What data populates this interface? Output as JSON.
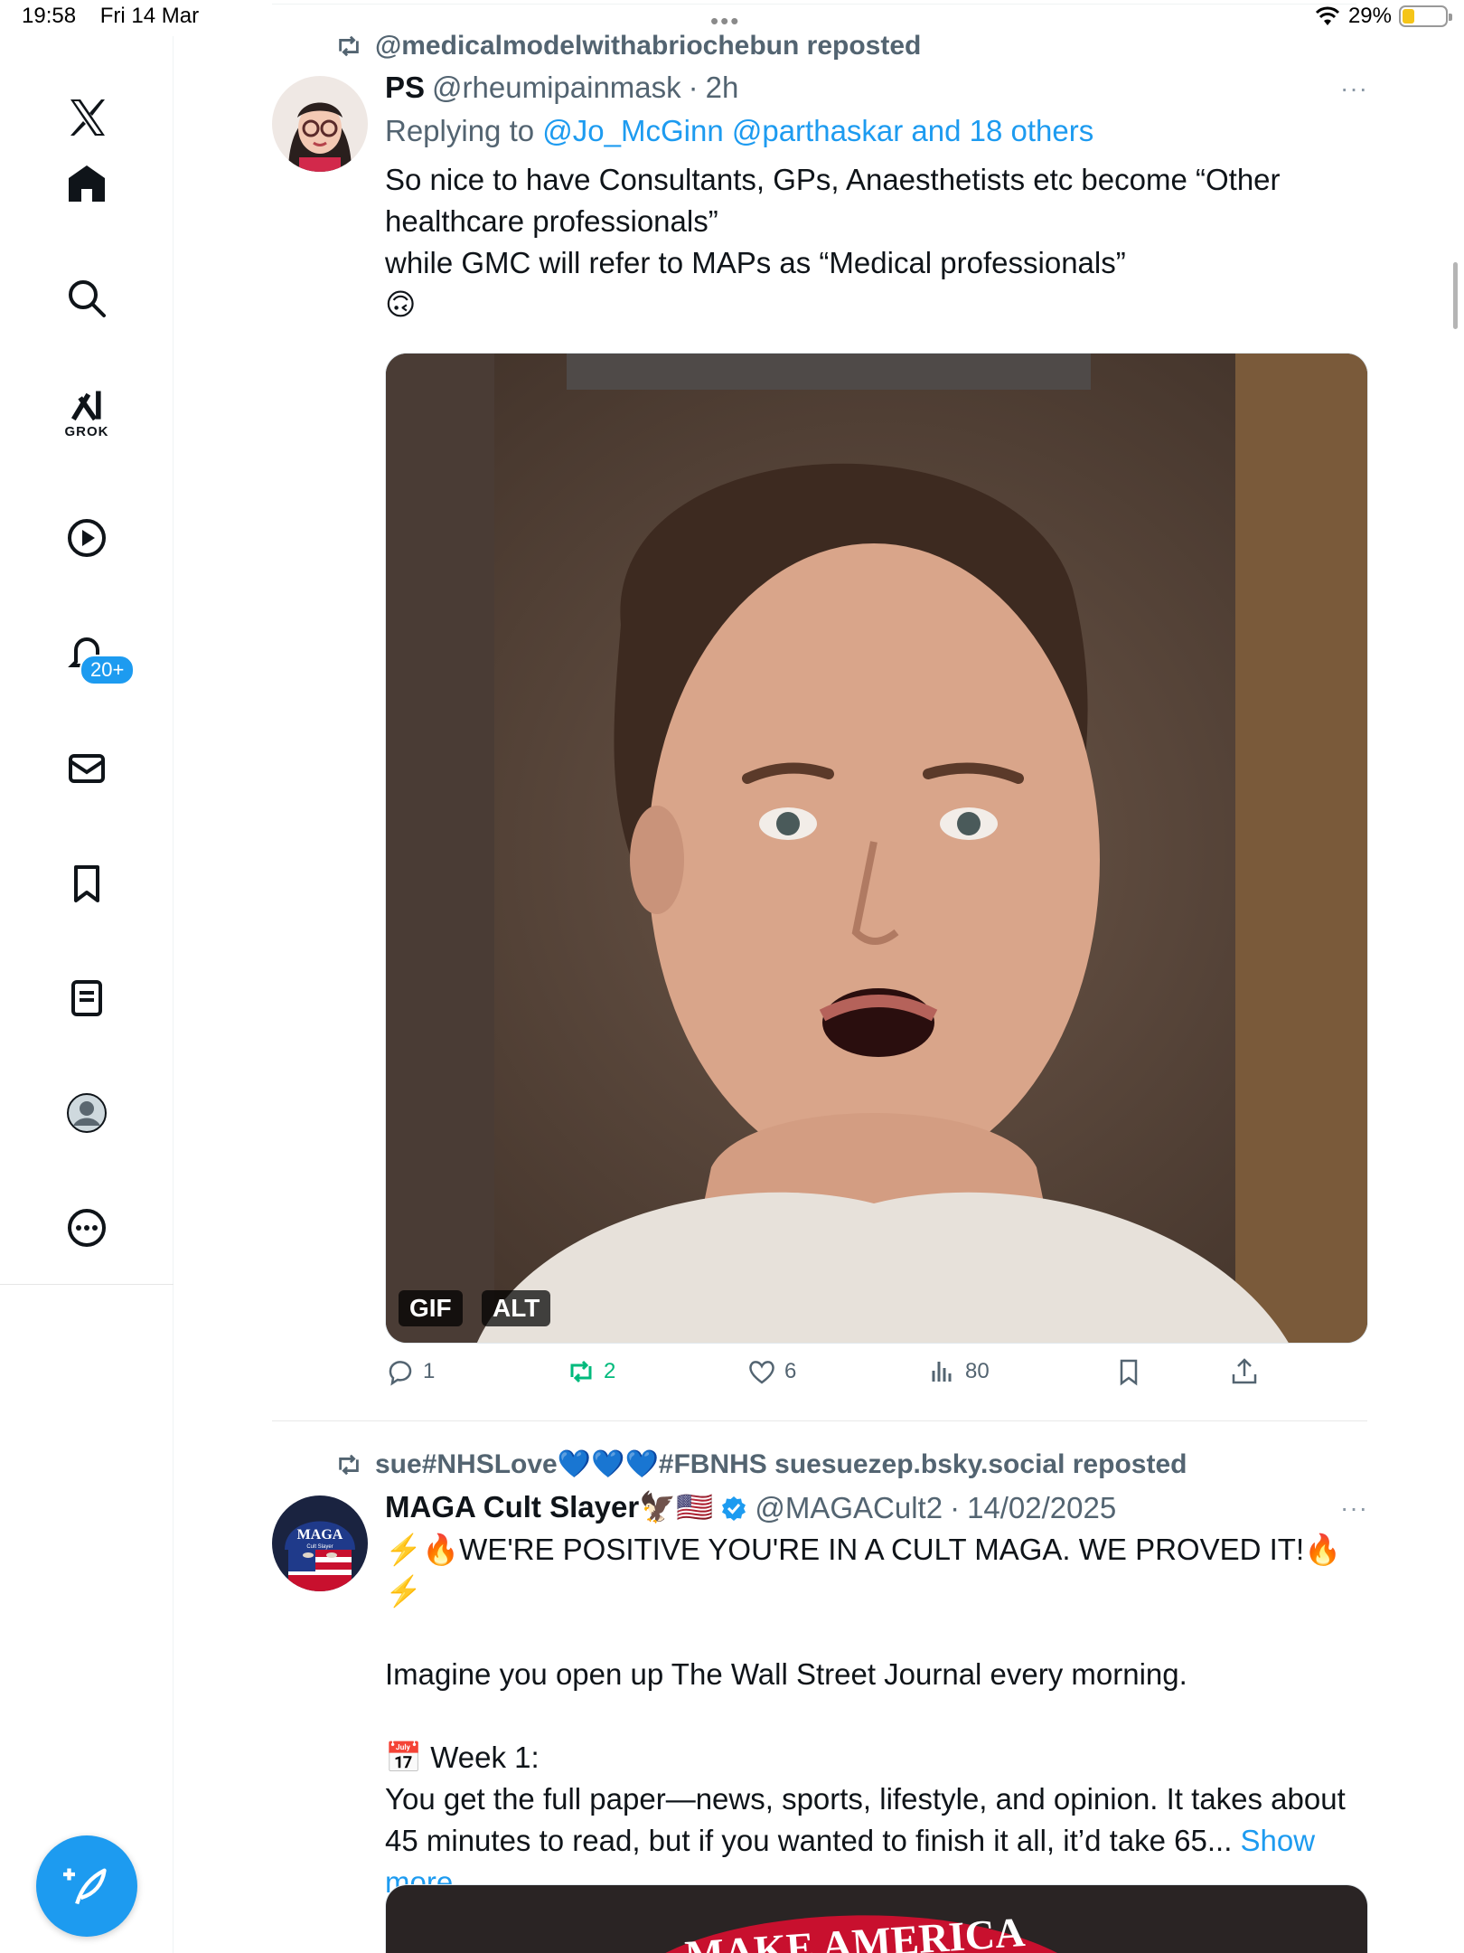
{
  "status_bar": {
    "time": "19:58",
    "date": "Fri 14 Mar",
    "dots": "•••",
    "battery": "29%",
    "battery_level": 0.29,
    "battery_color": "#f5c518"
  },
  "sidebar": {
    "items": [
      {
        "name": "x-logo",
        "icon": "x-logo-icon"
      },
      {
        "name": "home",
        "icon": "home-icon"
      },
      {
        "name": "explore",
        "icon": "search-icon"
      },
      {
        "name": "grok",
        "icon": "grok-icon",
        "label": "GROK"
      },
      {
        "name": "video",
        "icon": "play-icon"
      },
      {
        "name": "notifications",
        "icon": "bell-icon",
        "badge": "20+"
      },
      {
        "name": "messages",
        "icon": "mail-icon"
      },
      {
        "name": "bookmarks",
        "icon": "bookmark-icon"
      },
      {
        "name": "lists",
        "icon": "list-icon"
      },
      {
        "name": "profile",
        "icon": "profile-icon"
      },
      {
        "name": "more",
        "icon": "more-icon"
      }
    ],
    "compose_icon": "compose-icon",
    "accent": "#1d9bf0"
  },
  "tweets": [
    {
      "reposted_by": "@medicalmodelwithabriochebun reposted",
      "display_name": "PS",
      "handle": "@rheumipainmask",
      "separator": "·",
      "time": "2h",
      "more": "···",
      "reply_prefix": "Replying to",
      "reply_mentions": "@Jo_McGinn @parthaskar and 18 others",
      "text": "So nice to have Consultants, GPs, Anaesthetists etc become “Other healthcare professionals”\nwhile GMC will refer to MAPs as “Medical professionals”\n🙃",
      "media_tags": [
        "GIF",
        "ALT"
      ],
      "stats": {
        "replies": "1",
        "reposts": "2",
        "likes": "6",
        "views": "80"
      }
    },
    {
      "reposted_by": "sue#NHSLove💙💙💙#FBNHS suesuezep.bsky.social reposted",
      "display_name": "MAGA Cult Slayer🦅🇺🇸",
      "verified": true,
      "handle": "@MAGACult2",
      "separator": "·",
      "time": "14/02/2025",
      "more": "···",
      "avatar_text": "MAGA",
      "avatar_subtext": "Cult Slayer",
      "text": "⚡️🔥WE'RE POSITIVE YOU'RE IN A CULT MAGA. WE PROVED IT!🔥⚡️\n\nImagine you open up The Wall Street Journal every morning.\n\n📅 Week 1:\nYou get the full paper—news, sports, lifestyle, and opinion. It takes about 45 minutes to read, but if you wanted to finish it all, it’d take 65...",
      "show_more": "Show more",
      "media_caption": "MAKE AMERICA"
    }
  ]
}
